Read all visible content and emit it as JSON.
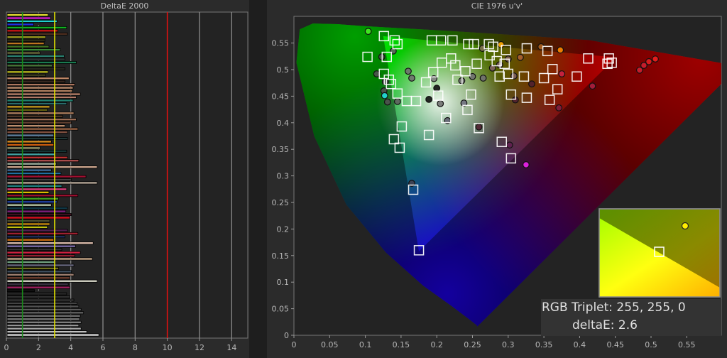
{
  "chart_data": [
    {
      "type": "bar",
      "orientation": "horizontal",
      "title": "DeltaE 2000",
      "xlim": [
        0,
        15
      ],
      "xticks": [
        "0",
        "2",
        "4",
        "6",
        "8",
        "10",
        "12",
        "14"
      ],
      "reference_lines": [
        {
          "value": 1,
          "color": "#1a8a1a"
        },
        {
          "value": 3,
          "color": "#e0e000"
        },
        {
          "value": 10,
          "color": "#e01010"
        }
      ],
      "values": [
        2.55,
        2.7,
        3.1,
        1.65,
        3.7,
        3.15,
        3.75,
        2.4,
        2.35,
        2.3,
        2.6,
        3.3,
        2.05,
        3.55,
        3.6,
        4.3,
        2.8,
        3.6,
        2.55,
        2.4,
        3.85,
        3.6,
        4.2,
        4.1,
        4.05,
        4.55,
        4.3,
        4.1,
        3.7,
        2.65,
        2.5,
        4.15,
        3.45,
        4.3,
        4.0,
        3.6,
        4.4,
        3.75,
        2.9,
        3.75,
        2.75,
        2.9,
        2.05,
        3.7,
        3.0,
        3.75,
        4.45,
        3.05,
        5.6,
        2.75,
        3.35,
        4.9,
        4.0,
        5.6,
        3.4,
        3.7,
        2.6,
        4.4,
        3.2,
        3.1,
        2.75,
        3.75,
        3.65,
        4.0,
        3.9,
        2.65,
        2.65,
        2.5,
        3.75,
        4.4,
        3.6,
        2.9,
        5.35,
        4.25,
        3.4,
        4.55,
        4.2,
        5.3,
        2.95,
        4.15,
        3.2,
        4.0,
        4.15,
        3.9,
        5.6,
        3.8,
        3.9,
        1.7,
        3.7,
        3.9,
        4.15,
        4.35,
        4.45,
        4.6,
        4.75,
        4.55,
        4.5,
        4.6,
        4.45,
        4.6,
        4.95,
        5.7
      ],
      "colors": [
        "#e8e030",
        "#e020e0",
        "#20d0d0",
        "#2030e0",
        "#10b020",
        "#d01818",
        "#503020",
        "#a0a020",
        "#303018",
        "#c07820",
        "#407020",
        "#3a8a3a",
        "#707040",
        "#2a8070",
        "#303838",
        "#1a7a50",
        "#4a7a3a",
        "#282820",
        "#c0c020",
        "#404020",
        "#c08868",
        "#382820",
        "#b07860",
        "#c09070",
        "#b08060",
        "#c08870",
        "#b07a68",
        "#208070",
        "#2a6a6a",
        "#d0a020",
        "#606010",
        "#b08060",
        "#503828",
        "#a07058",
        "#604030",
        "#c09070",
        "#a06848",
        "#805040",
        "#6080a0",
        "#203838",
        "#e09020",
        "#d06010",
        "#a0a070",
        "#183838",
        "#40a0a0",
        "#c03030",
        "#b05050",
        "#a0b0a0",
        "#d0a890",
        "#4070a0",
        "#2070a0",
        "#a01030",
        "#404040",
        "#c0b0a0",
        "#208080",
        "#e04080",
        "#e0c000",
        "#a01030",
        "#40a020",
        "#2040a0",
        "#c0d0b0",
        "#103848",
        "#802080",
        "#401020",
        "#e01020",
        "#505030",
        "#d09010",
        "#c0c010",
        "#502050",
        "#a02030",
        "#203060",
        "#d07010",
        "#e0c0b0",
        "#8070b0",
        "#303030",
        "#d02040",
        "#902030",
        "#d0b090",
        "#70a080",
        "#6a6a80",
        "#707020",
        "#405060",
        "#a08070",
        "#704030",
        "#e0e0d0",
        "#383040",
        "#a02060",
        "#101010",
        "#282828",
        "#303030",
        "#383838",
        "#444444",
        "#505050",
        "#5a5a5a",
        "#666666",
        "#707070",
        "#7a7a7a",
        "#888888",
        "#969696",
        "#a8a8a8",
        "#c0c0c0",
        "#e8e8e8"
      ]
    },
    {
      "type": "scatter",
      "title": "CIE 1976 u'v'",
      "xlim": [
        0,
        0.6
      ],
      "ylim": [
        0,
        0.6
      ],
      "xticks": [
        "0",
        "0.05",
        "0.1",
        "0.15",
        "0.2",
        "0.25",
        "0.3",
        "0.35",
        "0.4",
        "0.45",
        "0.5",
        "0.55"
      ],
      "yticks": [
        "0",
        "0.05",
        "0.1",
        "0.15",
        "0.2",
        "0.25",
        "0.3",
        "0.35",
        "0.4",
        "0.45",
        "0.5",
        "0.55"
      ],
      "gamut_primaries": {
        "red": [
          0.451,
          0.523
        ],
        "green": [
          0.125,
          0.563
        ],
        "blue": [
          0.175,
          0.158
        ]
      },
      "targets": [
        [
          0.126,
          0.563
        ],
        [
          0.141,
          0.555
        ],
        [
          0.145,
          0.548
        ],
        [
          0.103,
          0.524
        ],
        [
          0.13,
          0.524
        ],
        [
          0.193,
          0.555
        ],
        [
          0.206,
          0.555
        ],
        [
          0.222,
          0.555
        ],
        [
          0.244,
          0.548
        ],
        [
          0.252,
          0.548
        ],
        [
          0.273,
          0.548
        ],
        [
          0.126,
          0.492
        ],
        [
          0.133,
          0.481
        ],
        [
          0.136,
          0.473
        ],
        [
          0.145,
          0.455
        ],
        [
          0.158,
          0.441
        ],
        [
          0.171,
          0.441
        ],
        [
          0.202,
          0.451
        ],
        [
          0.195,
          0.495
        ],
        [
          0.207,
          0.513
        ],
        [
          0.226,
          0.508
        ],
        [
          0.24,
          0.497
        ],
        [
          0.256,
          0.511
        ],
        [
          0.274,
          0.527
        ],
        [
          0.279,
          0.543
        ],
        [
          0.297,
          0.537
        ],
        [
          0.326,
          0.54
        ],
        [
          0.355,
          0.535
        ],
        [
          0.412,
          0.521
        ],
        [
          0.441,
          0.521
        ],
        [
          0.445,
          0.513
        ],
        [
          0.439,
          0.511
        ],
        [
          0.288,
          0.487
        ],
        [
          0.3,
          0.492
        ],
        [
          0.295,
          0.511
        ],
        [
          0.322,
          0.487
        ],
        [
          0.35,
          0.484
        ],
        [
          0.362,
          0.501
        ],
        [
          0.396,
          0.487
        ],
        [
          0.369,
          0.463
        ],
        [
          0.304,
          0.453
        ],
        [
          0.326,
          0.447
        ],
        [
          0.358,
          0.443
        ],
        [
          0.248,
          0.453
        ],
        [
          0.259,
          0.39
        ],
        [
          0.189,
          0.377
        ],
        [
          0.291,
          0.364
        ],
        [
          0.151,
          0.393
        ],
        [
          0.14,
          0.369
        ],
        [
          0.148,
          0.353
        ],
        [
          0.304,
          0.333
        ],
        [
          0.167,
          0.274
        ],
        [
          0.175,
          0.16
        ],
        [
          0.213,
          0.409
        ],
        [
          0.243,
          0.424
        ],
        [
          0.185,
          0.476
        ],
        [
          0.229,
          0.481
        ],
        [
          0.22,
          0.521
        ],
        [
          0.284,
          0.516
        ]
      ],
      "measured": [
        {
          "u": 0.104,
          "v": 0.572,
          "color": "#44ee22"
        },
        {
          "u": 0.139,
          "v": 0.535,
          "color": "#606060"
        },
        {
          "u": 0.123,
          "v": 0.524,
          "color": "#505050"
        },
        {
          "u": 0.116,
          "v": 0.492,
          "color": "#505050"
        },
        {
          "u": 0.16,
          "v": 0.497,
          "color": "#707070"
        },
        {
          "u": 0.165,
          "v": 0.484,
          "color": "#707070"
        },
        {
          "u": 0.128,
          "v": 0.477,
          "color": "#505050"
        },
        {
          "u": 0.126,
          "v": 0.46,
          "color": "#505050"
        },
        {
          "u": 0.127,
          "v": 0.451,
          "color": "#22dddd"
        },
        {
          "u": 0.131,
          "v": 0.439,
          "color": "#505050"
        },
        {
          "u": 0.145,
          "v": 0.44,
          "color": "#606060"
        },
        {
          "u": 0.196,
          "v": 0.483,
          "color": "#808080"
        },
        {
          "u": 0.2,
          "v": 0.465,
          "color": "#111111"
        },
        {
          "u": 0.189,
          "v": 0.444,
          "color": "#111111"
        },
        {
          "u": 0.205,
          "v": 0.436,
          "color": "#707070"
        },
        {
          "u": 0.235,
          "v": 0.479,
          "color": "#707070"
        },
        {
          "u": 0.25,
          "v": 0.487,
          "color": "#707070"
        },
        {
          "u": 0.265,
          "v": 0.484,
          "color": "#707070"
        },
        {
          "u": 0.278,
          "v": 0.503,
          "color": "#806060"
        },
        {
          "u": 0.288,
          "v": 0.509,
          "color": "#806060"
        },
        {
          "u": 0.3,
          "v": 0.52,
          "color": "#806050"
        },
        {
          "u": 0.317,
          "v": 0.523,
          "color": "#aa6030"
        },
        {
          "u": 0.373,
          "v": 0.537,
          "color": "#ff8800"
        },
        {
          "u": 0.346,
          "v": 0.543,
          "color": "#aa6020"
        },
        {
          "u": 0.308,
          "v": 0.488,
          "color": "#806060"
        },
        {
          "u": 0.31,
          "v": 0.443,
          "color": "#502030"
        },
        {
          "u": 0.333,
          "v": 0.473,
          "color": "#502030"
        },
        {
          "u": 0.375,
          "v": 0.492,
          "color": "#cc2244"
        },
        {
          "u": 0.371,
          "v": 0.428,
          "color": "#802040"
        },
        {
          "u": 0.418,
          "v": 0.469,
          "color": "#aa2040"
        },
        {
          "u": 0.484,
          "v": 0.499,
          "color": "#cc2030"
        },
        {
          "u": 0.49,
          "v": 0.508,
          "color": "#cc2030"
        },
        {
          "u": 0.497,
          "v": 0.515,
          "color": "#dd2020"
        },
        {
          "u": 0.506,
          "v": 0.52,
          "color": "#ee2020"
        },
        {
          "u": 0.259,
          "v": 0.392,
          "color": "#502030"
        },
        {
          "u": 0.302,
          "v": 0.358,
          "color": "#602050"
        },
        {
          "u": 0.325,
          "v": 0.321,
          "color": "#ee22ee"
        },
        {
          "u": 0.165,
          "v": 0.286,
          "color": "#404050"
        },
        {
          "u": 0.29,
          "v": 0.547,
          "color": "#ffaa00"
        },
        {
          "u": 0.264,
          "v": 0.54,
          "color": "#807050"
        },
        {
          "u": 0.238,
          "v": 0.437,
          "color": "#707080"
        },
        {
          "u": 0.215,
          "v": 0.404,
          "color": "#606070"
        }
      ]
    }
  ],
  "inset": {
    "rgb_triplet": "RGB Triplet: 255, 255, 0",
    "delta_e": "deltaE: 2.6",
    "measured_color": "#ffee00"
  }
}
